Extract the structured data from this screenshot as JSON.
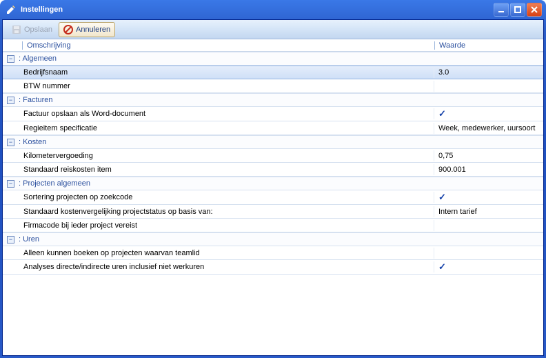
{
  "window": {
    "title": "Instellingen"
  },
  "toolbar": {
    "save_label": "Opslaan",
    "cancel_label": "Annuleren"
  },
  "columns": {
    "description": "Omschrijving",
    "value": "Waarde"
  },
  "groups": [
    {
      "name": "Algemeen",
      "label": ": Algemeen",
      "rows": [
        {
          "label": "Bedrijfsnaam",
          "value": "3.0",
          "value_type": "text",
          "selected": true
        },
        {
          "label": "BTW nummer",
          "value": "",
          "value_type": "text"
        }
      ]
    },
    {
      "name": "Facturen",
      "label": ": Facturen",
      "rows": [
        {
          "label": "Factuur opslaan als Word-document",
          "value": "",
          "value_type": "check"
        },
        {
          "label": "Regieitem specificatie",
          "value": "Week, medewerker, uursoort",
          "value_type": "text"
        }
      ]
    },
    {
      "name": "Kosten",
      "label": ": Kosten",
      "rows": [
        {
          "label": "Kilometervergoeding",
          "value": "0,75",
          "value_type": "text"
        },
        {
          "label": "Standaard reiskosten item",
          "value": "900.001",
          "value_type": "text"
        }
      ]
    },
    {
      "name": "Projecten algemeen",
      "label": ": Projecten algemeen",
      "rows": [
        {
          "label": "Sortering projecten op zoekcode",
          "value": "",
          "value_type": "check"
        },
        {
          "label": "Standaard kostenvergelijking projectstatus op basis van:",
          "value": "Intern tarief",
          "value_type": "text"
        },
        {
          "label": "Firmacode bij ieder project vereist",
          "value": "",
          "value_type": "text"
        }
      ]
    },
    {
      "name": "Uren",
      "label": ": Uren",
      "rows": [
        {
          "label": "Alleen kunnen boeken op projecten waarvan teamlid",
          "value": "",
          "value_type": "text"
        },
        {
          "label": "Analyses directe/indirecte uren inclusief niet werkuren",
          "value": "",
          "value_type": "check"
        }
      ]
    }
  ]
}
